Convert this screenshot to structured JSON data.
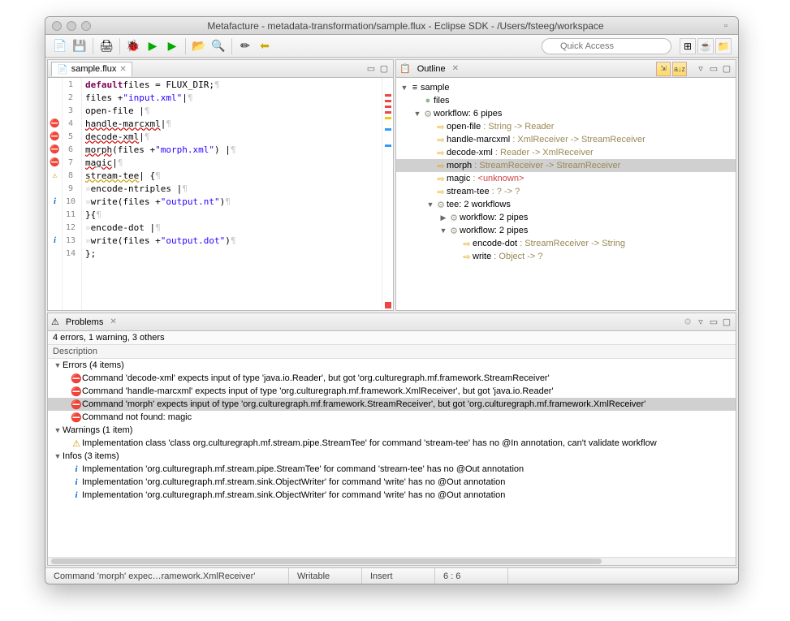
{
  "window": {
    "title": "Metafacture - metadata-transformation/sample.flux - Eclipse SDK - /Users/fsteeg/workspace"
  },
  "toolbar": {
    "quick_access_placeholder": "Quick Access"
  },
  "editor": {
    "tab_label": "sample.flux",
    "lines": [
      {
        "n": 1,
        "gutter": "",
        "segments": [
          {
            "t": "default",
            "c": "kw"
          },
          {
            "t": " files = FLUX_DIR;",
            "c": ""
          },
          {
            "t": " ¶",
            "c": "ws"
          }
        ]
      },
      {
        "n": 2,
        "gutter": "",
        "fold": "-",
        "segments": [
          {
            "t": "files + ",
            "c": ""
          },
          {
            "t": "\"input.xml\"",
            "c": "str"
          },
          {
            "t": " |",
            "c": ""
          },
          {
            "t": " ¶",
            "c": "ws"
          }
        ]
      },
      {
        "n": 3,
        "gutter": "",
        "fold": "-",
        "segments": [
          {
            "t": "open-file |",
            "c": ""
          },
          {
            "t": " ¶",
            "c": "ws"
          }
        ]
      },
      {
        "n": 4,
        "gutter": "err",
        "segments": [
          {
            "t": "handle-marcxml",
            "c": "underline-err"
          },
          {
            "t": " |",
            "c": ""
          },
          {
            "t": " ¶",
            "c": "ws"
          }
        ]
      },
      {
        "n": 5,
        "gutter": "err",
        "segments": [
          {
            "t": "decode-xml",
            "c": "underline-err"
          },
          {
            "t": " |",
            "c": ""
          },
          {
            "t": " ¶",
            "c": "ws"
          }
        ]
      },
      {
        "n": 6,
        "gutter": "err",
        "segments": [
          {
            "t": "morph",
            "c": "underline-err"
          },
          {
            "t": "(files + ",
            "c": ""
          },
          {
            "t": "\"morph.xml\"",
            "c": "str"
          },
          {
            "t": ") |",
            "c": ""
          },
          {
            "t": " ¶",
            "c": "ws"
          }
        ]
      },
      {
        "n": 7,
        "gutter": "err",
        "segments": [
          {
            "t": "magic",
            "c": "underline-err"
          },
          {
            "t": " |",
            "c": ""
          },
          {
            "t": " ¶",
            "c": "ws"
          }
        ]
      },
      {
        "n": 8,
        "gutter": "warn",
        "fold": "-",
        "segments": [
          {
            "t": "stream-tee",
            "c": "underline-warn"
          },
          {
            "t": " | {",
            "c": ""
          },
          {
            "t": " ¶",
            "c": "ws"
          }
        ]
      },
      {
        "n": 9,
        "gutter": "",
        "fold": "-",
        "segments": [
          {
            "t": "» ",
            "c": "ws"
          },
          {
            "t": "encode-ntriples |",
            "c": ""
          },
          {
            "t": " ¶",
            "c": "ws"
          }
        ]
      },
      {
        "n": 10,
        "gutter": "info",
        "segments": [
          {
            "t": "» ",
            "c": "ws"
          },
          {
            "t": "write(files + ",
            "c": ""
          },
          {
            "t": "\"output.nt\"",
            "c": "str"
          },
          {
            "t": ")",
            "c": ""
          },
          {
            "t": " ¶",
            "c": "ws"
          }
        ]
      },
      {
        "n": 11,
        "gutter": "",
        "segments": [
          {
            "t": "}{",
            "c": ""
          },
          {
            "t": " ¶",
            "c": "ws"
          }
        ]
      },
      {
        "n": 12,
        "gutter": "",
        "fold": "-",
        "segments": [
          {
            "t": "» ",
            "c": "ws"
          },
          {
            "t": "encode-dot |",
            "c": ""
          },
          {
            "t": " ¶",
            "c": "ws"
          }
        ]
      },
      {
        "n": 13,
        "gutter": "info",
        "segments": [
          {
            "t": "» ",
            "c": "ws"
          },
          {
            "t": "write(files + ",
            "c": ""
          },
          {
            "t": "\"output.dot\"",
            "c": "str"
          },
          {
            "t": ")",
            "c": ""
          },
          {
            "t": " ¶",
            "c": "ws"
          }
        ]
      },
      {
        "n": 14,
        "gutter": "",
        "segments": [
          {
            "t": "};",
            "c": ""
          }
        ]
      }
    ]
  },
  "outline": {
    "tab_label": "Outline",
    "tree": [
      {
        "indent": 0,
        "twisty": "▼",
        "icon": "≡",
        "label": [
          {
            "t": "sample",
            "c": ""
          }
        ]
      },
      {
        "indent": 1,
        "twisty": "",
        "icon": "●",
        "iconClass": "ic-circle",
        "label": [
          {
            "t": "files",
            "c": ""
          }
        ]
      },
      {
        "indent": 1,
        "twisty": "▼",
        "icon": "⚙",
        "iconClass": "ic-gear",
        "label": [
          {
            "t": "workflow: 6 pipes",
            "c": ""
          }
        ]
      },
      {
        "indent": 2,
        "twisty": "",
        "icon": "⇨",
        "iconClass": "ic-arrow",
        "label": [
          {
            "t": "open-file",
            "c": "cmd"
          },
          {
            "t": " : String -> Reader",
            "c": "type"
          }
        ]
      },
      {
        "indent": 2,
        "twisty": "",
        "icon": "⇨",
        "iconClass": "ic-arrow",
        "label": [
          {
            "t": "handle-marcxml",
            "c": "cmd"
          },
          {
            "t": " : XmlReceiver -> StreamReceiver",
            "c": "type"
          }
        ]
      },
      {
        "indent": 2,
        "twisty": "",
        "icon": "⇨",
        "iconClass": "ic-arrow",
        "label": [
          {
            "t": "decode-xml",
            "c": "cmd"
          },
          {
            "t": " : Reader -> XmlReceiver",
            "c": "type"
          }
        ]
      },
      {
        "indent": 2,
        "twisty": "",
        "icon": "⇨",
        "iconClass": "ic-arrow",
        "sel": true,
        "label": [
          {
            "t": "morph",
            "c": "cmd"
          },
          {
            "t": " : StreamReceiver -> StreamReceiver",
            "c": "type"
          }
        ]
      },
      {
        "indent": 2,
        "twisty": "",
        "icon": "⇨",
        "iconClass": "ic-arrow",
        "label": [
          {
            "t": "magic",
            "c": "cmd"
          },
          {
            "t": " : ",
            "c": "type"
          },
          {
            "t": "<unknown>",
            "c": "unk"
          }
        ]
      },
      {
        "indent": 2,
        "twisty": "",
        "icon": "⇨",
        "iconClass": "ic-arrow",
        "label": [
          {
            "t": "stream-tee",
            "c": "cmd"
          },
          {
            "t": " : ? -> ?",
            "c": "type"
          }
        ]
      },
      {
        "indent": 2,
        "twisty": "▼",
        "icon": "⚙",
        "iconClass": "ic-gear",
        "label": [
          {
            "t": "tee: 2 workflows",
            "c": ""
          }
        ]
      },
      {
        "indent": 3,
        "twisty": "▶",
        "icon": "⚙",
        "iconClass": "ic-gear",
        "label": [
          {
            "t": "workflow: 2 pipes",
            "c": ""
          }
        ]
      },
      {
        "indent": 3,
        "twisty": "▼",
        "icon": "⚙",
        "iconClass": "ic-gear",
        "label": [
          {
            "t": "workflow: 2 pipes",
            "c": ""
          }
        ]
      },
      {
        "indent": 4,
        "twisty": "",
        "icon": "⇨",
        "iconClass": "ic-arrow",
        "label": [
          {
            "t": "encode-dot",
            "c": "cmd"
          },
          {
            "t": " : StreamReceiver -> String",
            "c": "type"
          }
        ]
      },
      {
        "indent": 4,
        "twisty": "",
        "icon": "⇨",
        "iconClass": "ic-arrow",
        "label": [
          {
            "t": "write",
            "c": "cmd"
          },
          {
            "t": " : Object -> ?",
            "c": "type"
          }
        ]
      }
    ]
  },
  "problems": {
    "tab_label": "Problems",
    "summary": "4 errors, 1 warning, 3 others",
    "description_header": "Description",
    "groups": [
      {
        "twisty": "▼",
        "label": "Errors (4 items)",
        "items": [
          {
            "icon": "err",
            "text": "Command 'decode-xml' expects input of type 'java.io.Reader', but got 'org.culturegraph.mf.framework.StreamReceiver'"
          },
          {
            "icon": "err",
            "text": "Command 'handle-marcxml' expects input of type 'org.culturegraph.mf.framework.XmlReceiver', but got 'java.io.Reader'"
          },
          {
            "icon": "err",
            "sel": true,
            "text": "Command 'morph' expects input of type 'org.culturegraph.mf.framework.StreamReceiver', but got 'org.culturegraph.mf.framework.XmlReceiver'"
          },
          {
            "icon": "err",
            "text": "Command not found: magic"
          }
        ]
      },
      {
        "twisty": "▼",
        "label": "Warnings (1 item)",
        "items": [
          {
            "icon": "warn",
            "text": "Implementation class 'class org.culturegraph.mf.stream.pipe.StreamTee' for command 'stream-tee' has no @In annotation, can't validate workflow"
          }
        ]
      },
      {
        "twisty": "▼",
        "label": "Infos (3 items)",
        "items": [
          {
            "icon": "info",
            "text": "Implementation 'org.culturegraph.mf.stream.pipe.StreamTee' for command 'stream-tee' has no @Out annotation"
          },
          {
            "icon": "info",
            "text": "Implementation 'org.culturegraph.mf.stream.sink.ObjectWriter' for command 'write' has no @Out annotation"
          },
          {
            "icon": "info",
            "text": "Implementation 'org.culturegraph.mf.stream.sink.ObjectWriter' for command 'write' has no @Out annotation"
          }
        ]
      }
    ]
  },
  "statusbar": {
    "message": "Command 'morph' expec…ramework.XmlReceiver'",
    "writable": "Writable",
    "insert": "Insert",
    "position": "6 : 6"
  }
}
